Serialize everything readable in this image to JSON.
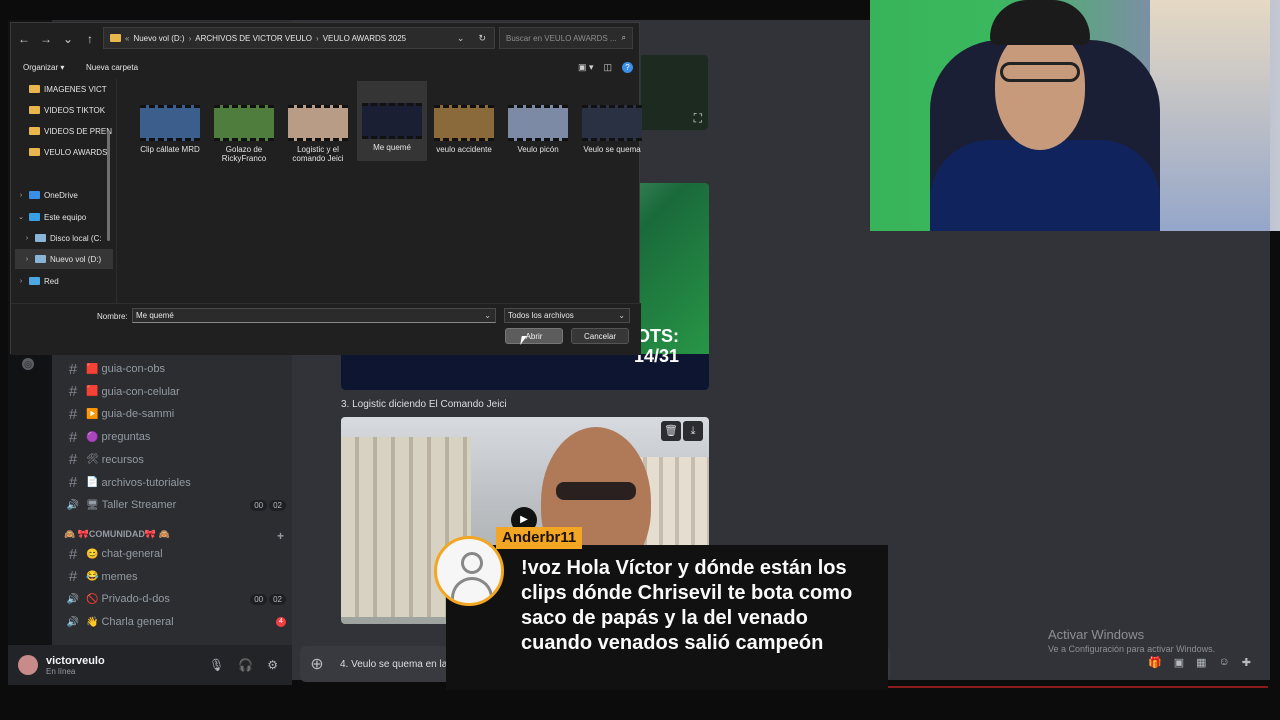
{
  "discord": {
    "channels": [
      {
        "emoji": "🟥",
        "name": "guia-con-obs",
        "type": "text"
      },
      {
        "emoji": "🟥",
        "name": "guia-con-celular",
        "type": "text"
      },
      {
        "emoji": "▶️",
        "name": "guia-de-sammi",
        "type": "text"
      },
      {
        "emoji": "🟣",
        "name": "preguntas",
        "type": "text"
      },
      {
        "emoji": "🛠",
        "name": "recursos",
        "type": "text"
      },
      {
        "emoji": "📄",
        "name": "archivos-tutoriales",
        "type": "text"
      },
      {
        "emoji": "🖥",
        "name": "Taller Streamer",
        "type": "voice",
        "counts": [
          "00",
          "02"
        ]
      }
    ],
    "category": {
      "label": "🙈 🎀COMUNIDAD🎀 🙈",
      "plus": "+"
    },
    "community_channels": [
      {
        "emoji": "😊",
        "name": "chat-general",
        "type": "text"
      },
      {
        "emoji": "😂",
        "name": "memes",
        "type": "text"
      },
      {
        "emoji": "🚫",
        "name": "Privado-d-dos",
        "type": "voice",
        "counts": [
          "00",
          "02"
        ]
      },
      {
        "emoji": "👋",
        "name": "Charla general",
        "type": "voice",
        "ping": "4"
      }
    ],
    "user": {
      "name": "victorveulo",
      "status": "En línea"
    },
    "message_title": "3. Logistic diciendo El Comando Jeici",
    "media1_overlay": "OTS:\n14/31",
    "chat_input_text": "4. Veulo se quema en la",
    "media_tools": [
      "🗑",
      "⤓"
    ]
  },
  "dialog": {
    "back": "←",
    "forward": "→",
    "down": "⌄",
    "up": "↑",
    "breadcrumb": [
      "Nuevo vol (D:)",
      "ARCHIVOS DE VICTOR VEULO",
      "VEULO AWARDS 2025"
    ],
    "search_placeholder": "Buscar en VEULO AWARDS ...",
    "toolbar": {
      "organize": "Organizar ▾",
      "new_folder": "Nueva carpeta"
    },
    "nav_items": [
      {
        "label": "IMAGENES VICT",
        "kind": "folder"
      },
      {
        "label": "VIDEOS TIKTOK",
        "kind": "folder"
      },
      {
        "label": "VIDEOS DE PREN",
        "kind": "folder"
      },
      {
        "label": "VEULO AWARDS",
        "kind": "folder"
      },
      {
        "label": "OneDrive",
        "kind": "cloud"
      },
      {
        "label": "Este equipo",
        "kind": "pc"
      },
      {
        "label": "Disco local (C:",
        "kind": "drive"
      },
      {
        "label": "Nuevo vol (D:)",
        "kind": "drive"
      },
      {
        "label": "Red",
        "kind": "network"
      }
    ],
    "files": [
      {
        "name": "Clip cállate MRD",
        "thumb": "#3b5e8c"
      },
      {
        "name": "Golazo de RickyFranco",
        "thumb": "#4f7d3e"
      },
      {
        "name": "Logistic y el comando Jeici",
        "thumb": "#b89c86"
      },
      {
        "name": "Me quemé",
        "thumb": "#1b1f33"
      },
      {
        "name": "veulo accidente",
        "thumb": "#8a6a3a"
      },
      {
        "name": "Veulo picón",
        "thumb": "#7d8aa5"
      },
      {
        "name": "Veulo se quema",
        "thumb": "#2a3142"
      }
    ],
    "name_label": "Nombre:",
    "name_value": "Me quemé",
    "file_type": "Todos los archivos",
    "open_label": "Abrir",
    "cancel_label": "Cancelar"
  },
  "tts": {
    "username": "Anderbr11",
    "message": "!voz Hola Víctor y dónde están los clips dónde Chrisevil te bota como saco de papás y la del venado cuando venados salió campeón"
  },
  "windows_activation": {
    "title": "Activar Windows",
    "subtitle": "Ve a Configuración para activar Windows."
  }
}
